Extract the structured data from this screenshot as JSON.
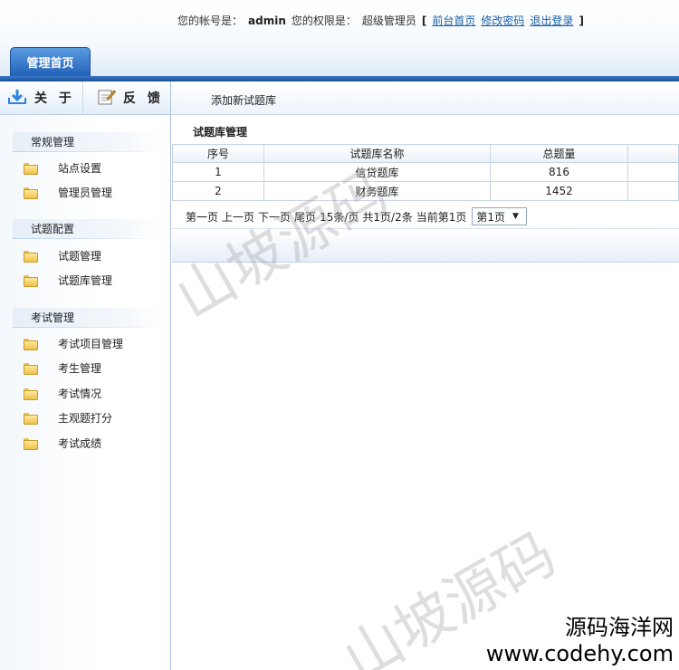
{
  "header": {
    "account_label": "您的帐号是：",
    "account": "admin",
    "role_label": "您的权限是：",
    "role": "超级管理员",
    "bracket_open": "[",
    "bracket_close": "]",
    "links": [
      "前台首页",
      "修改密码",
      "退出登录"
    ],
    "home_tab": "管理首页"
  },
  "left_toolbar": {
    "about_label": "关 于",
    "about_icon": "download-icon",
    "feedback_label": "反 馈",
    "feedback_icon": "edit-note-icon"
  },
  "sidebar": {
    "groups": [
      {
        "title": "常规管理",
        "items": [
          "站点设置",
          "管理员管理"
        ]
      },
      {
        "title": "试题配置",
        "items": [
          "试题管理",
          "试题库管理"
        ]
      },
      {
        "title": "考试管理",
        "items": [
          "考试项目管理",
          "考生管理",
          "考试情况",
          "主观题打分",
          "考试成绩"
        ]
      }
    ],
    "item_icon": "folder-icon"
  },
  "main": {
    "toolbar_action": "添加新试题库",
    "panel_title": "试题库管理",
    "table": {
      "headers": [
        "序号",
        "试题库名称",
        "总题量",
        ""
      ],
      "rows": [
        [
          "1",
          "信贷题库",
          "816",
          ""
        ],
        [
          "2",
          "财务题库",
          "1452",
          ""
        ]
      ]
    },
    "pager": {
      "first": "第一页",
      "prev": "上一页",
      "next": "下一页",
      "last": "尾页",
      "per_page": "15条/页",
      "summary": "共1页/2条",
      "current": "当前第1页",
      "select_value": "第1页"
    }
  },
  "watermark": {
    "text": "山坡源码",
    "brand_cn": "源码海洋网",
    "brand_en": "www.codehy.com"
  }
}
